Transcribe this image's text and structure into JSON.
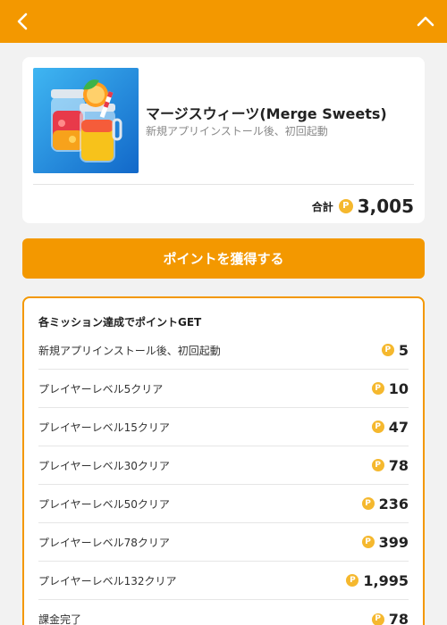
{
  "icons": {
    "back": "chevron-left-icon",
    "collapse": "chevron-up-icon",
    "point": "point-coin-icon"
  },
  "colors": {
    "accent": "#f39800",
    "coin": "#f5b82e"
  },
  "coin_symbol": "P",
  "app": {
    "title": "マージスウィーツ(Merge Sweets)",
    "subtitle": "新規アプリインストール後、初回起動",
    "total_label": "合計",
    "total_value": "3,005"
  },
  "cta_label": "ポイントを獲得する",
  "missions": {
    "header": "各ミッション達成でポイントGET",
    "items": [
      {
        "name": "新規アプリインストール後、初回起動",
        "points": "5"
      },
      {
        "name": "プレイヤーレベル5クリア",
        "points": "10"
      },
      {
        "name": "プレイヤーレベル15クリア",
        "points": "47"
      },
      {
        "name": "プレイヤーレベル30クリア",
        "points": "78"
      },
      {
        "name": "プレイヤーレベル50クリア",
        "points": "236"
      },
      {
        "name": "プレイヤーレベル78クリア",
        "points": "399"
      },
      {
        "name": "プレイヤーレベル132クリア",
        "points": "1,995"
      },
      {
        "name": "課金完了",
        "points": "78"
      }
    ]
  }
}
